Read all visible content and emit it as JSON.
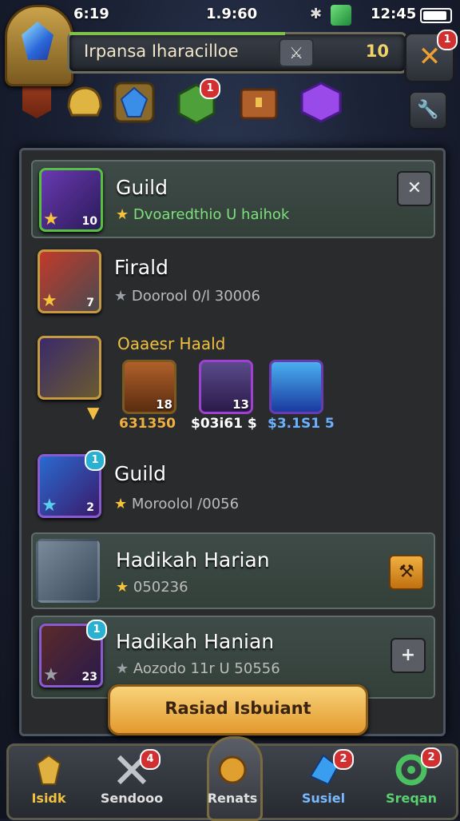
{
  "status_bar": {
    "time_left": "6:19",
    "time_center": "1.9:60",
    "time_right": "12:45"
  },
  "header": {
    "title": "Irpansa Iharacilloe",
    "level": "10",
    "close_badge": "1"
  },
  "resource_badges": {
    "green_box": "1"
  },
  "rows": [
    {
      "title": "Guild",
      "subtitle": "Dvoaredthio U haihok",
      "icon_count": "10"
    },
    {
      "title": "Firald",
      "subtitle": "Doorool 0/l 30006",
      "icon_count": "7"
    },
    {
      "title": "Oaaesr Haald",
      "items": [
        {
          "count": "18",
          "price": "631350"
        },
        {
          "count": "13",
          "price": "$03i61 $"
        },
        {
          "count": "",
          "price": "$3.1S1 5"
        }
      ]
    },
    {
      "title": "Guild",
      "subtitle": "Moroolol /0056",
      "icon_count": "2",
      "badge": "1"
    },
    {
      "title": "Hadikah Harian",
      "subtitle": "050236"
    },
    {
      "title": "Hadikah Hanian",
      "subtitle": "Aozodo 11r U 50556",
      "icon_count": "23",
      "badge": "1"
    }
  ],
  "action_button": {
    "label": "Rasiad Isbuiant"
  },
  "bottom_nav": [
    {
      "label": "Isidk"
    },
    {
      "label": "Sendooo",
      "badge": "4"
    },
    {
      "label": "Renats"
    },
    {
      "label": "Susiel",
      "badge": "2"
    },
    {
      "label": "Sreqan",
      "badge": "2"
    }
  ],
  "colors": {
    "panel": "#2a2b2d",
    "highlight_row": "#3e4b48",
    "accent_gold": "#f0a030",
    "button": "#f8d27a"
  },
  "icons": [
    "crystal-avatar-icon",
    "sword-icon",
    "close-icon",
    "wrench-icon",
    "helmet-icon",
    "blue-gem-icon",
    "green-box-icon",
    "chest-icon",
    "purple-cube-icon"
  ]
}
